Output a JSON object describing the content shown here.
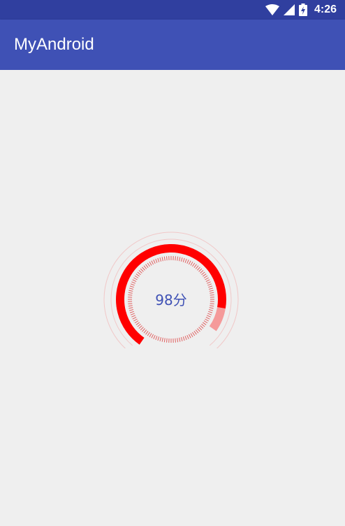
{
  "status_bar": {
    "time": "4:26",
    "icons": [
      "wifi-icon",
      "cell-signal-icon",
      "battery-charging-icon"
    ]
  },
  "app_bar": {
    "title": "MyAndroid"
  },
  "gauge": {
    "score_text": "98分",
    "score": 98,
    "colors": {
      "arc": "#ff0000",
      "arc_end_highlight": "#f59a9a",
      "ticks": "#e06060",
      "outer_ring": "#f0c8c8",
      "text": "#3f51b5"
    }
  }
}
